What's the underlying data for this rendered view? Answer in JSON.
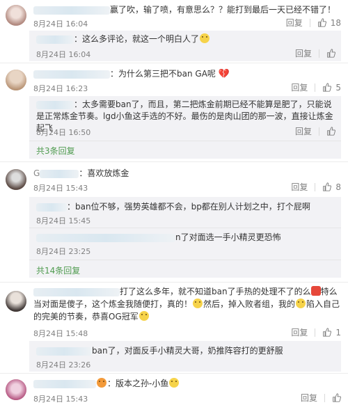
{
  "actions": {
    "reply": "回复",
    "like_icon": "thumb-up-icon",
    "share_icon": "share-icon"
  },
  "c1": {
    "text": "赢了吹，输了喷，有意思么？？能打到最后一天已经不错了！",
    "date": "8月24日 16:04",
    "likes": "18",
    "reply": {
      "text": "：这么多评论，就这一个明白人了",
      "date": "8月24日 16:04"
    }
  },
  "c2": {
    "text": "：为什么第三把不ban GA呢",
    "date": "8月24日 16:23",
    "likes": "5",
    "reply": {
      "text": "：太多需要ban了，而且，第二把炼金前期已经不能算是肥了，只能说是正常炼金节奏。lgd小鱼这手选的不好。最伤的是肉山团的那一波，直接让炼金起飞",
      "date": "8月24日 16:50"
    },
    "more": "共3条回复"
  },
  "c3": {
    "name": "G",
    "text": "：喜欢放炼金",
    "date": "8月24日 15:43",
    "likes": "8",
    "reply1": {
      "text": "：ban位不够，强势英雄都不会，bp都在别人计划之中，打个屁啊",
      "date": "8月24日 15:45"
    },
    "reply2": {
      "text": "n了对面选一手小精灵更恐怖",
      "date": "8月24日 23:25"
    },
    "more": "共14条回复"
  },
  "c4": {
    "text_a": "打了这么多年，就不知道ban了手热的处理不了的么",
    "text_b": "特么当对面是傻子，这个炼金我随便打，真的！",
    "text_c": "然后，掉入败者组，我的",
    "text_d": "陷入自己的完美的节奏，恭喜OG冠军",
    "date": "8月24日 15:48",
    "likes": "1",
    "reply": {
      "text": "ban了，对面反手小精灵大哥，奶推阵容打的更舒服",
      "date": "8月24日 23:26"
    }
  },
  "c5": {
    "text": "：版本之孙-小鱼",
    "date": "8月24日 15:43",
    "likes": ""
  }
}
